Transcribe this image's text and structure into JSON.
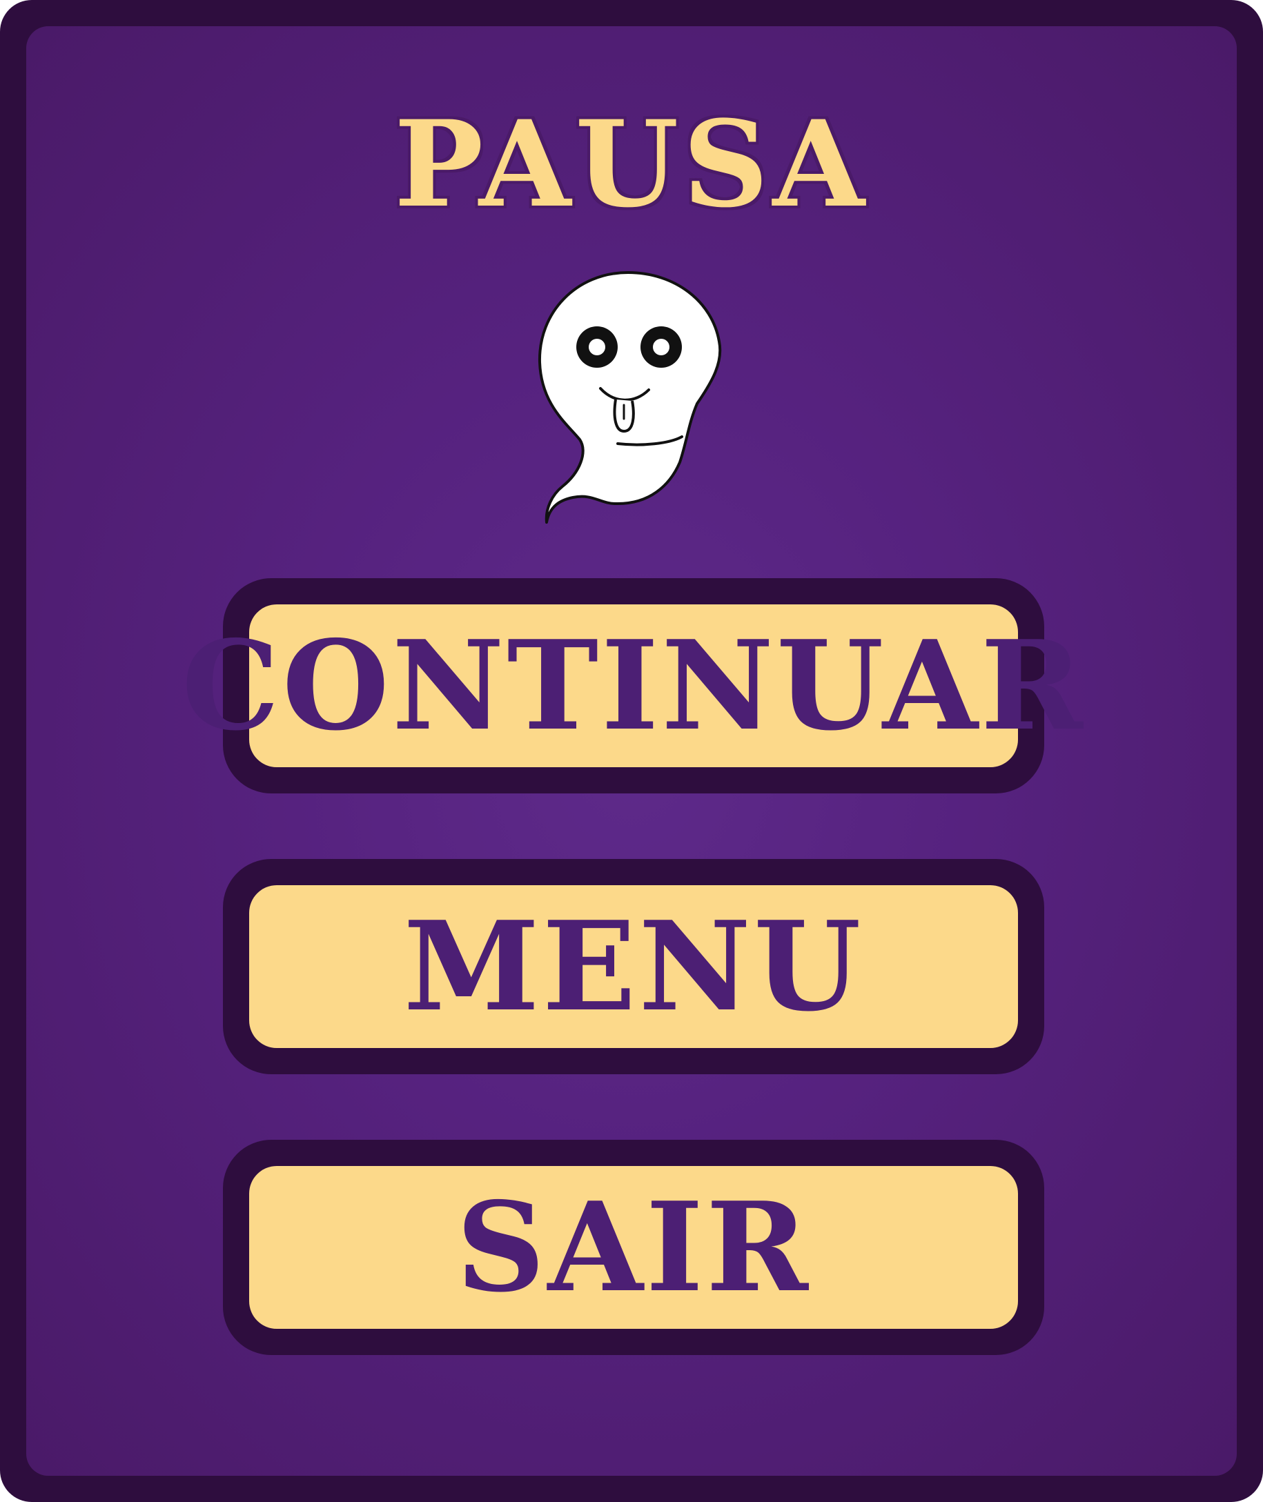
{
  "pause_menu": {
    "title": "PAUSA",
    "mascot_icon": "ghost-icon",
    "buttons": [
      {
        "label": "CONTINUAR"
      },
      {
        "label": "MENU"
      },
      {
        "label": "SAIR"
      }
    ]
  },
  "colors": {
    "frame": "#2e0d3e",
    "panel": "#56227f",
    "title_text": "#fcd98a",
    "button_fill": "#fcd98a",
    "button_text": "#4c1f74"
  }
}
